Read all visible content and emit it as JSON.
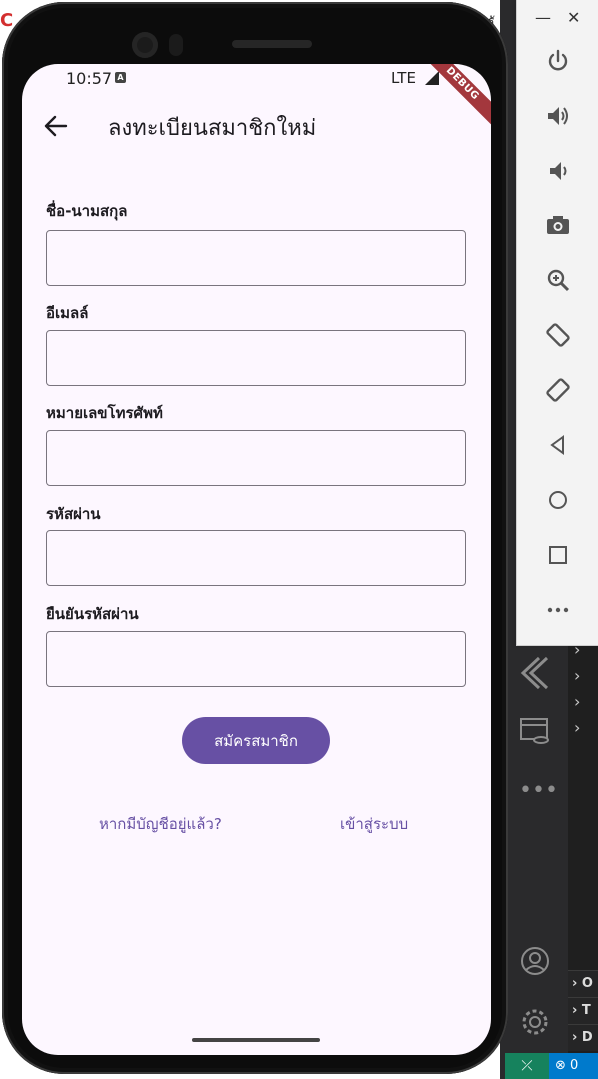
{
  "status_bar": {
    "time": "10:57",
    "network": "LTE",
    "debug_banner": "DEBUG"
  },
  "appbar": {
    "title": "ลงทะเบียนสมาชิกใหม่"
  },
  "form": {
    "fields": [
      {
        "label": "ชื่อ-นามสกุล",
        "value": "",
        "placeholder": ""
      },
      {
        "label": "อีเมลล์",
        "value": "",
        "placeholder": ""
      },
      {
        "label": "หมายเลขโทรศัพท์",
        "value": "",
        "placeholder": ""
      },
      {
        "label": "รหัสผ่าน",
        "value": "",
        "placeholder": ""
      },
      {
        "label": "ยืนยันรหัสผ่าน",
        "value": "",
        "placeholder": ""
      }
    ],
    "submit_label": "สมัครสมาชิก"
  },
  "footer": {
    "have_account_text": "หากมีบัญชีอยู่แล้ว?",
    "login_link": "เข้าสู่ระบบ"
  },
  "emulator_toolbar": {
    "buttons": [
      "power-icon",
      "volume-up-icon",
      "volume-down-icon",
      "camera-icon",
      "zoom-icon",
      "rotate-left-icon",
      "rotate-right-icon",
      "back-icon",
      "home-icon",
      "overview-icon",
      "more-icon"
    ]
  },
  "ide": {
    "panel_rows": [
      "O",
      "T",
      "D"
    ],
    "status_errors": "0"
  },
  "colors": {
    "primary": "#6750a4",
    "screen_bg": "#fdf7ff",
    "outline": "#79747e",
    "debug_ribbon": "#a3373d"
  }
}
